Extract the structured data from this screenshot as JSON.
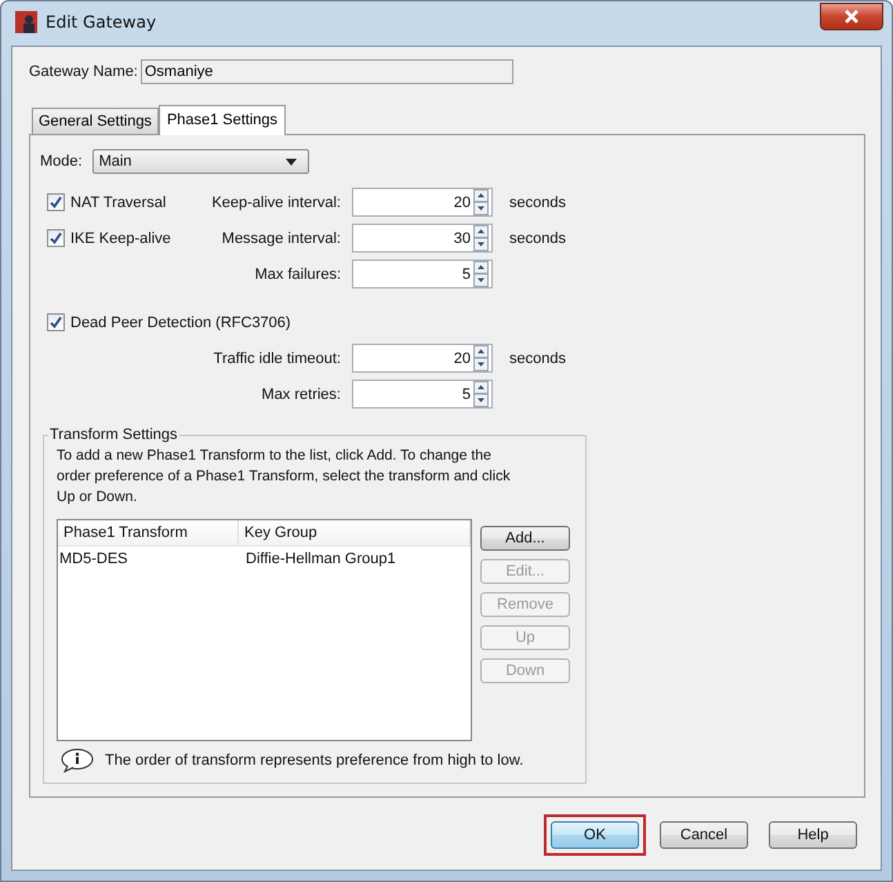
{
  "window": {
    "title": "Edit Gateway"
  },
  "gateway_name": {
    "label": "Gateway Name:",
    "value": "Osmaniye"
  },
  "tabs": [
    {
      "label": "General Settings",
      "selected": false
    },
    {
      "label": "Phase1 Settings",
      "selected": true
    }
  ],
  "mode": {
    "label": "Mode:",
    "value": "Main"
  },
  "groups": [
    {
      "rows": [
        {
          "checkbox": {
            "label": "NAT Traversal",
            "checked": true
          },
          "field": {
            "label": "Keep-alive interval:",
            "value": "20",
            "unit": "seconds"
          }
        },
        {
          "checkbox": {
            "label": "IKE Keep-alive",
            "checked": true
          },
          "field": {
            "label": "Message interval:",
            "value": "30",
            "unit": "seconds"
          }
        },
        {
          "field": {
            "label": "Max failures:",
            "value": "5"
          }
        }
      ]
    },
    {
      "rows": [
        {
          "checkbox": {
            "label": "Dead Peer Detection (RFC3706)",
            "checked": true
          }
        },
        {
          "field": {
            "label": "Traffic idle timeout:",
            "value": "20",
            "unit": "seconds"
          }
        },
        {
          "field": {
            "label": "Max retries:",
            "value": "5"
          }
        }
      ]
    }
  ],
  "transform_settings": {
    "title": "Transform Settings",
    "description": "To add a new Phase1 Transform to the list, click Add. To change the order preference of a Phase1 Transform, select the transform and click Up or Down.",
    "table": {
      "columns": [
        "Phase1 Transform",
        "Key Group"
      ],
      "rows": [
        [
          "MD5-DES",
          "Diffie-Hellman Group1"
        ]
      ]
    },
    "buttons": [
      {
        "label": "Add...",
        "disabled": false
      },
      {
        "label": "Edit...",
        "disabled": true
      },
      {
        "label": "Remove",
        "disabled": true
      },
      {
        "label": "Up",
        "disabled": true
      },
      {
        "label": "Down",
        "disabled": true
      }
    ],
    "note": "The order of transform represents preference from high to low."
  },
  "buttons": [
    {
      "label": "OK",
      "highlighted": true
    },
    {
      "label": "Cancel",
      "highlighted": false
    },
    {
      "label": "Help",
      "highlighted": false
    }
  ]
}
